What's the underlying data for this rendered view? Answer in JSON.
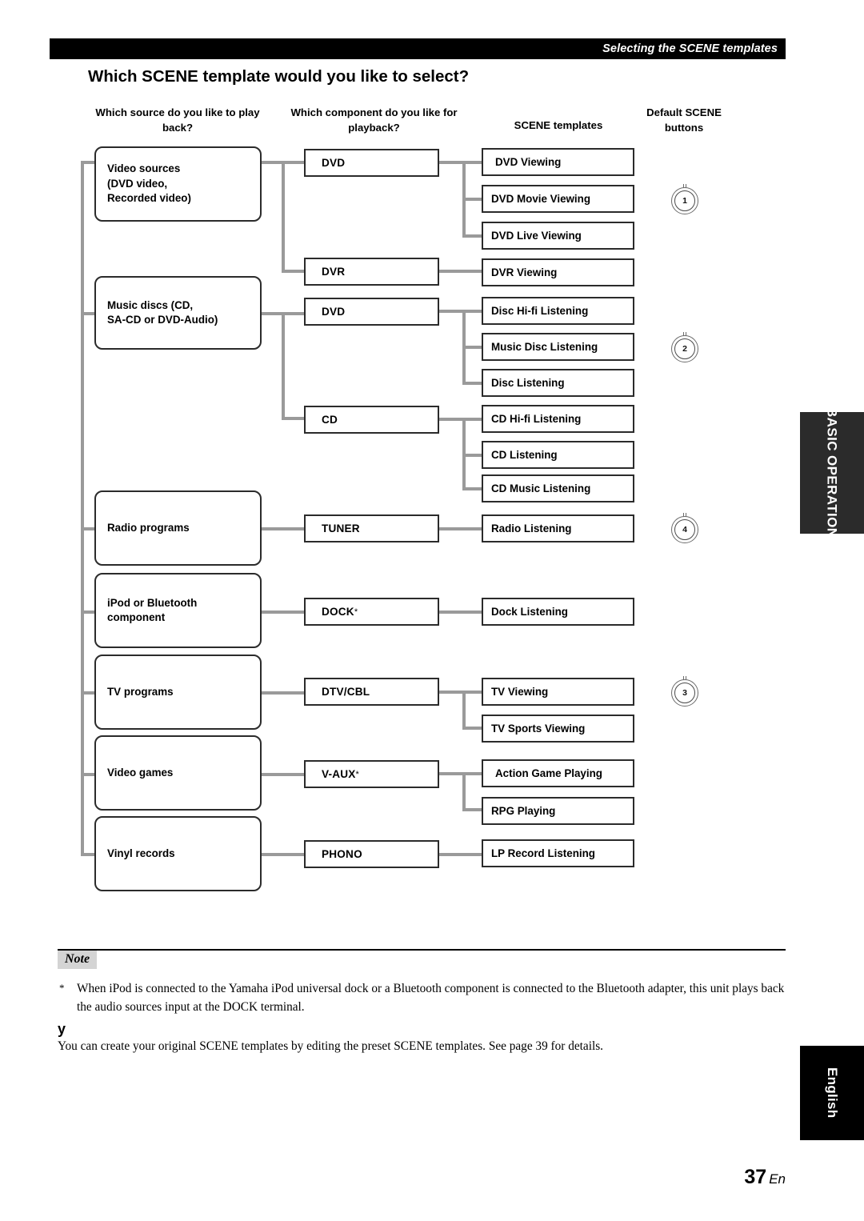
{
  "header": {
    "running_head": "Selecting the SCENE templates",
    "title": "Which SCENE template would you like to select?"
  },
  "column_headers": {
    "source": "Which source do you like to play back?",
    "component": "Which component do you like for playback?",
    "templates": "SCENE templates",
    "buttons": "Default SCENE buttons"
  },
  "diagram": {
    "sources": [
      {
        "id": "video-sources",
        "label": "Video sources (DVD video, Recorded video)"
      },
      {
        "id": "music-discs",
        "label": "Music discs (CD, SA-CD or DVD-Audio)"
      },
      {
        "id": "radio-programs",
        "label": "Radio programs"
      },
      {
        "id": "ipod-bluetooth",
        "label": "iPod or Bluetooth component"
      },
      {
        "id": "tv-programs",
        "label": "TV programs"
      },
      {
        "id": "video-games",
        "label": "Video games"
      },
      {
        "id": "vinyl-records",
        "label": "Vinyl records"
      }
    ],
    "components": [
      {
        "id": "dvd-video",
        "label": "DVD",
        "footnote": ""
      },
      {
        "id": "dvr",
        "label": "DVR",
        "footnote": ""
      },
      {
        "id": "dvd-audio",
        "label": "DVD",
        "footnote": ""
      },
      {
        "id": "cd",
        "label": "CD",
        "footnote": ""
      },
      {
        "id": "tuner",
        "label": "TUNER",
        "footnote": ""
      },
      {
        "id": "dock",
        "label": "DOCK",
        "footnote": "*"
      },
      {
        "id": "dtv-cbl",
        "label": "DTV/CBL",
        "footnote": ""
      },
      {
        "id": "v-aux",
        "label": "V-AUX",
        "footnote": "*"
      },
      {
        "id": "phono",
        "label": "PHONO",
        "footnote": ""
      }
    ],
    "templates": [
      {
        "id": "dvd-viewing",
        "label": "DVD Viewing"
      },
      {
        "id": "dvd-movie-viewing",
        "label": "DVD Movie Viewing"
      },
      {
        "id": "dvd-live-viewing",
        "label": "DVD Live Viewing"
      },
      {
        "id": "dvr-viewing",
        "label": "DVR Viewing"
      },
      {
        "id": "disc-hifi-listening",
        "label": "Disc Hi-fi Listening"
      },
      {
        "id": "music-disc-listening",
        "label": "Music Disc Listening"
      },
      {
        "id": "disc-listening",
        "label": "Disc Listening"
      },
      {
        "id": "cd-hifi-listening",
        "label": "CD Hi-fi Listening"
      },
      {
        "id": "cd-listening",
        "label": "CD Listening"
      },
      {
        "id": "cd-music-listening",
        "label": "CD Music Listening"
      },
      {
        "id": "radio-listening",
        "label": "Radio Listening"
      },
      {
        "id": "dock-listening",
        "label": "Dock Listening"
      },
      {
        "id": "tv-viewing",
        "label": "TV Viewing"
      },
      {
        "id": "tv-sports-viewing",
        "label": "TV Sports Viewing"
      },
      {
        "id": "action-game-playing",
        "label": "Action Game Playing"
      },
      {
        "id": "rpg-playing",
        "label": "RPG Playing"
      },
      {
        "id": "lp-record-listening",
        "label": "LP Record Listening"
      }
    ],
    "scene_buttons": [
      {
        "id": "scene-button-1",
        "number": "1"
      },
      {
        "id": "scene-button-2",
        "number": "2"
      },
      {
        "id": "scene-button-4",
        "number": "4"
      },
      {
        "id": "scene-button-3",
        "number": "3"
      }
    ]
  },
  "note": {
    "tag": "Note",
    "asterisk": "*",
    "text": "When iPod is connected to the Yamaha iPod universal dock or a Bluetooth component is connected to the Bluetooth adapter, this unit plays back the audio sources input at the DOCK terminal."
  },
  "tip": {
    "mark": "y",
    "text": "You can create your original SCENE templates by editing the preset SCENE templates. See page 39 for details."
  },
  "side_tabs": {
    "section": "BASIC OPERATION",
    "language": "English"
  },
  "footer": {
    "page_number": "37",
    "page_suffix": "En"
  },
  "colors": {
    "bar": "#000000",
    "connector": "#9a9a9a",
    "box_border": "#2b2b2b",
    "tab_section": "#2b2b2b",
    "tab_language": "#000000"
  }
}
